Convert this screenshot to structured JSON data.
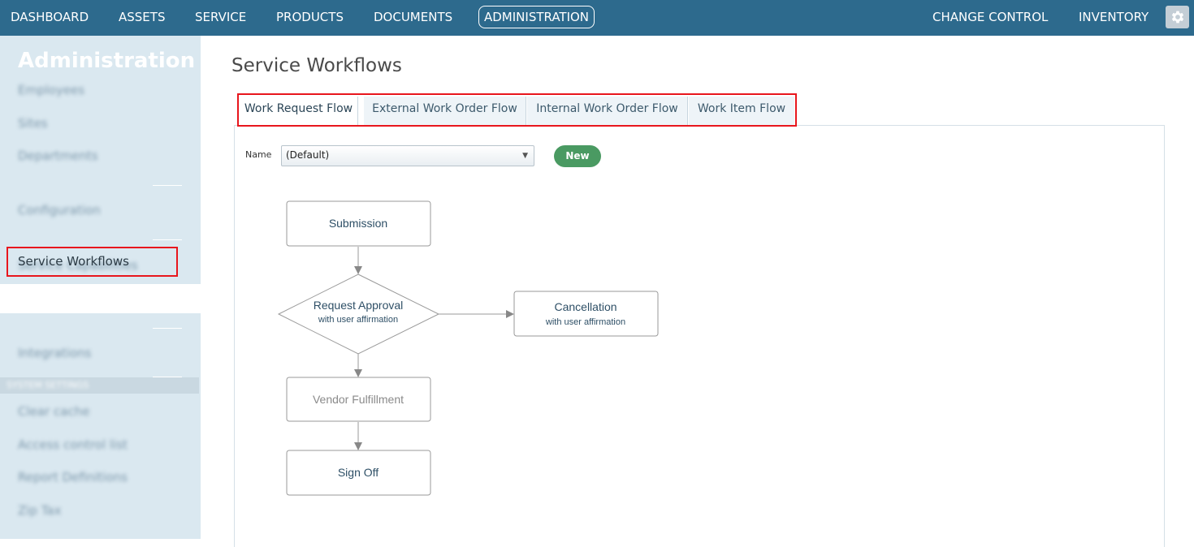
{
  "topnav": {
    "left_items": [
      "DASHBOARD",
      "ASSETS",
      "SERVICE",
      "PRODUCTS",
      "DOCUMENTS",
      "ADMINISTRATION"
    ],
    "active_item": "ADMINISTRATION",
    "right_items": [
      "CHANGE CONTROL",
      "INVENTORY"
    ],
    "settings_icon": "gear-icon"
  },
  "sidebar": {
    "title": "Administration",
    "groups": [
      [
        "Employees",
        "Sites",
        "Departments"
      ],
      [
        "Configuration"
      ],
      [
        "Service Capabilities",
        "Service Workflows"
      ],
      [
        "Integrations"
      ]
    ],
    "section_label": "SYSTEM SETTINGS",
    "section_items": [
      "Clear cache",
      "Access control list",
      "Report Definitions",
      "Zip Tax"
    ],
    "active_item": "Service Workflows"
  },
  "main": {
    "title": "Service Workflows",
    "tabs": [
      "Work Request Flow",
      "External Work Order Flow",
      "Internal Work Order Flow",
      "Work Item Flow"
    ],
    "active_tab": "Work Request Flow",
    "name_label": "Name",
    "name_select_value": "(Default)",
    "new_button": "New"
  },
  "workflow": {
    "nodes": {
      "submission": {
        "label": "Submission"
      },
      "approval": {
        "label": "Request Approval",
        "sublabel": "with user affirmation"
      },
      "cancellation": {
        "label": "Cancellation",
        "sublabel": "with user affirmation"
      },
      "fulfillment": {
        "label": "Vendor Fulfillment"
      },
      "signoff": {
        "label": "Sign Off"
      }
    },
    "colors": {
      "node_text": "#2e4f66",
      "muted_text": "#8a8a8a",
      "border": "#9a9a9a",
      "arrow": "#888888"
    }
  }
}
